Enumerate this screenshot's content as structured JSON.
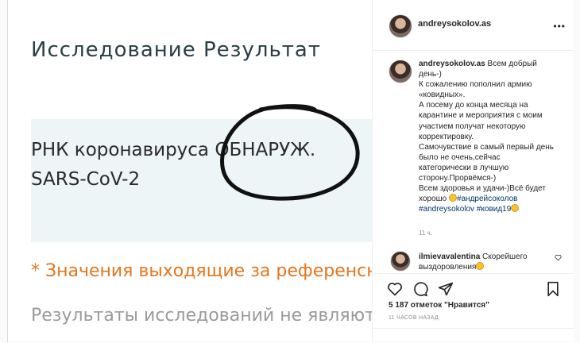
{
  "document": {
    "title": "Исследование  Результат",
    "rna_line": "РНК коронавируса  ОБНАРУЖ.",
    "virus_line": "SARS-CoV-2",
    "footnote": "* Значения выходящие за референсны",
    "results_line": "Результаты исследований не являются",
    "colors": {
      "title": "#2b3e44",
      "band": "#eef5f6",
      "footnote": "#e4761f"
    }
  },
  "header": {
    "username": "andreysokolov.as",
    "more_icon": "more-horizontal-icon"
  },
  "caption": {
    "username": "andreysokolov.as",
    "text": "Всем добрый день-)\nК сожалению пополнил армию «ковидных».\nА посему до конца месяца на карантине и мероприятия с моим участием получат некоторую корректировку.\nСамочувствие в самый первый день было не очень,сейчас категорически в лучшую сторону.Прорвёмся-)\nВсем здоровья и удачи-)Всё будет хорошо",
    "hashtag1": "#андрейсоколов",
    "hashtag2": "#andreysokolov",
    "hashtag3": "#ковид19",
    "time": "11 ч."
  },
  "comment": {
    "username": "ilmievavalentina",
    "text": "Скорейшего выздоровления"
  },
  "actions": {
    "icons": [
      "heart-icon",
      "comment-icon",
      "share-icon",
      "bookmark-icon"
    ]
  },
  "likes": "5 187 отметок \"Нравится\"",
  "posted_ago": "11 ЧАСОВ НАЗАД"
}
